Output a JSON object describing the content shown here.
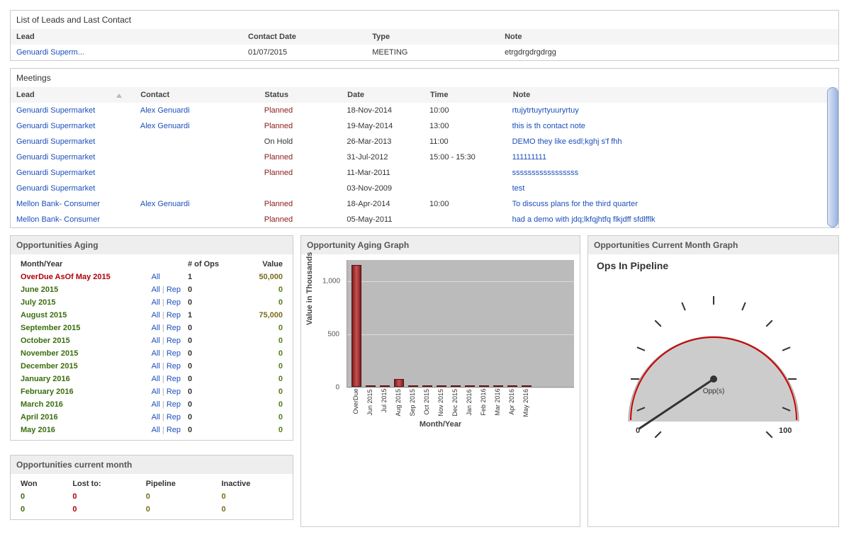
{
  "leads_panel": {
    "title": "List of Leads and Last Contact",
    "headers": {
      "lead": "Lead",
      "contact_date": "Contact Date",
      "type": "Type",
      "note": "Note"
    },
    "rows": [
      {
        "lead": "Genuardi Superm...",
        "contact_date": "01/07/2015",
        "type": "MEETING",
        "note": "etrgdrgdrgdrgg"
      }
    ]
  },
  "meetings_panel": {
    "title": "Meetings",
    "headers": {
      "lead": "Lead",
      "contact": "Contact",
      "status": "Status",
      "date": "Date",
      "time": "Time",
      "note": "Note"
    },
    "rows": [
      {
        "lead": "Genuardi Supermarket",
        "contact": "Alex Genuardi",
        "status": "Planned",
        "status_kind": "planned",
        "date": "18-Nov-2014",
        "time": "10:00",
        "note": "rtujytrtuyrtyuuryrtuy"
      },
      {
        "lead": "Genuardi Supermarket",
        "contact": "Alex Genuardi",
        "status": "Planned",
        "status_kind": "planned",
        "date": "19-May-2014",
        "time": "13:00",
        "note": "this is th contact note"
      },
      {
        "lead": "Genuardi Supermarket",
        "contact": "",
        "status": "On Hold",
        "status_kind": "onhold",
        "date": "26-Mar-2013",
        "time": "11:00",
        "note": "DEMO they like esdl;kghj s'f fhh"
      },
      {
        "lead": "Genuardi Supermarket",
        "contact": "",
        "status": "Planned",
        "status_kind": "planned",
        "date": "31-Jul-2012",
        "time": "15:00 - 15:30",
        "note": "111111111"
      },
      {
        "lead": "Genuardi Supermarket",
        "contact": "",
        "status": "Planned",
        "status_kind": "planned",
        "date": "11-Mar-2011",
        "time": "",
        "note": "sssssssssssssssss"
      },
      {
        "lead": "Genuardi Supermarket",
        "contact": "",
        "status": "",
        "status_kind": "",
        "date": "03-Nov-2009",
        "time": "",
        "note": "test"
      },
      {
        "lead": "Mellon Bank- Consumer",
        "contact": "Alex Genuardi",
        "status": "Planned",
        "status_kind": "planned",
        "date": "18-Apr-2014",
        "time": "10:00",
        "note": "To discuss plans for the third quarter"
      },
      {
        "lead": "Mellon Bank- Consumer",
        "contact": "",
        "status": "Planned",
        "status_kind": "planned",
        "date": "05-May-2011",
        "time": "",
        "note": "had a demo with jdq;lkfqjhtfq flkjdff sfdlfflk"
      }
    ]
  },
  "aging_panel": {
    "title": "Opportunities Aging",
    "headers": {
      "month": "Month/Year",
      "ops": "# of Ops",
      "value": "Value"
    },
    "link_all": "All",
    "link_rep": "Rep",
    "rows": [
      {
        "month": "OverDue AsOf May 2015",
        "overdue": true,
        "single_all": true,
        "ops": "1",
        "value": "50,000",
        "nonzero": true
      },
      {
        "month": "June 2015",
        "ops": "0",
        "value": "0"
      },
      {
        "month": "July 2015",
        "ops": "0",
        "value": "0"
      },
      {
        "month": "August 2015",
        "ops": "1",
        "value": "75,000",
        "nonzero": true
      },
      {
        "month": "September 2015",
        "ops": "0",
        "value": "0"
      },
      {
        "month": "October 2015",
        "ops": "0",
        "value": "0"
      },
      {
        "month": "November 2015",
        "ops": "0",
        "value": "0"
      },
      {
        "month": "December 2015",
        "ops": "0",
        "value": "0"
      },
      {
        "month": "January 2016",
        "ops": "0",
        "value": "0"
      },
      {
        "month": "February 2016",
        "ops": "0",
        "value": "0"
      },
      {
        "month": "March 2016",
        "ops": "0",
        "value": "0"
      },
      {
        "month": "April 2016",
        "ops": "0",
        "value": "0"
      },
      {
        "month": "May 2016",
        "ops": "0",
        "value": "0"
      }
    ]
  },
  "curmonth_panel": {
    "title": "Opportunities current month",
    "headers": {
      "won": "Won",
      "lost": "Lost to:",
      "pipeline": "Pipeline",
      "inactive": "Inactive"
    },
    "rows": [
      {
        "won": "0",
        "lost": "0",
        "pipeline": "0",
        "inactive": "0"
      },
      {
        "won": "0",
        "lost": "0",
        "pipeline": "0",
        "inactive": "0"
      }
    ]
  },
  "aging_graph": {
    "title": "Opportunity Aging Graph",
    "ylabel": "Value in Thousands",
    "xlabel": "Month/Year",
    "yticks": [
      "0",
      "500",
      "1,000"
    ]
  },
  "gauge_panel": {
    "title": "Opportunities Current Month Graph",
    "subtitle": "Ops In Pipeline",
    "center_label": "Opp(s)",
    "min": "0",
    "max": "100"
  },
  "chart_data": [
    {
      "type": "bar",
      "panel": "Opportunity Aging Graph",
      "xlabel": "Month/Year",
      "ylabel": "Value in Thousands",
      "ylim": [
        0,
        1200
      ],
      "categories": [
        "OverDue",
        "Jun 2015",
        "Jul 2015",
        "Aug 2015",
        "Sep 2015",
        "Oct 2015",
        "Nov 2015",
        "Dec 2015",
        "Jan 2016",
        "Feb 2016",
        "Mar 2016",
        "Apr 2016",
        "May 2016"
      ],
      "values": [
        1150,
        0,
        0,
        75,
        0,
        0,
        0,
        0,
        0,
        0,
        0,
        0,
        0
      ]
    },
    {
      "type": "gauge",
      "panel": "Opportunities Current Month Graph",
      "title": "Ops In Pipeline",
      "min": 0,
      "max": 100,
      "value": 0,
      "label": "Opp(s)"
    }
  ]
}
